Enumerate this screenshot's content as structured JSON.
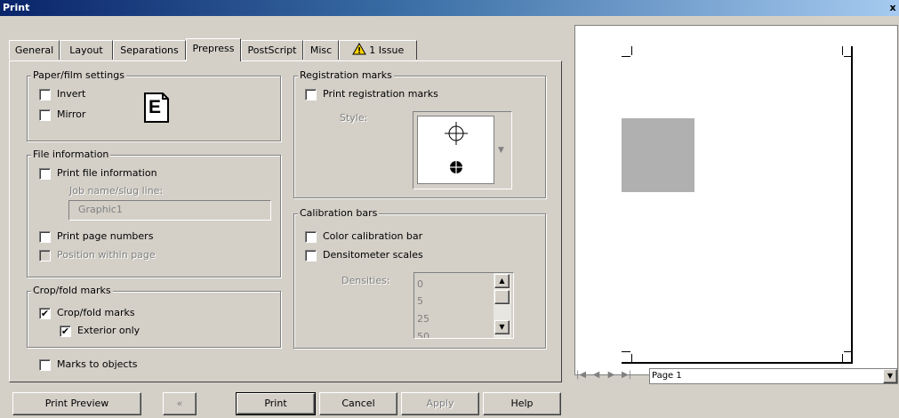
{
  "window": {
    "title": "Print",
    "close_glyph": "x"
  },
  "tabs": [
    {
      "label": "General",
      "active": false
    },
    {
      "label": "Layout",
      "active": false
    },
    {
      "label": "Separations",
      "active": false
    },
    {
      "label": "Prepress",
      "active": true
    },
    {
      "label": "PostScript",
      "active": false
    },
    {
      "label": "Misc",
      "active": false
    },
    {
      "label": "1 Issue",
      "active": false,
      "icon": "warning-icon"
    }
  ],
  "paper_film": {
    "legend": "Paper/film settings",
    "invert": {
      "label": "Invert",
      "checked": false
    },
    "mirror": {
      "label": "Mirror",
      "checked": false
    },
    "preview_letter": "E"
  },
  "file_info": {
    "legend": "File information",
    "print_file_info": {
      "label": "Print file information",
      "checked": false
    },
    "job_name_label": "Job name/slug line:",
    "job_name_value": "Graphic1",
    "print_page_numbers": {
      "label": "Print page numbers",
      "checked": false
    },
    "position_within_page": {
      "label": "Position within page",
      "checked": false,
      "disabled": true
    }
  },
  "crop_fold": {
    "legend": "Crop/fold marks",
    "crop_fold_marks": {
      "label": "Crop/fold marks",
      "checked": true
    },
    "exterior_only": {
      "label": "Exterior only",
      "checked": true
    }
  },
  "marks_to_objects": {
    "label": "Marks to objects",
    "checked": false
  },
  "registration": {
    "legend": "Registration marks",
    "print_registration_marks": {
      "label": "Print registration marks",
      "checked": false
    },
    "style_label": "Style:"
  },
  "calibration": {
    "legend": "Calibration bars",
    "color_calibration_bar": {
      "label": "Color calibration bar",
      "checked": false
    },
    "densitometer_scales": {
      "label": "Densitometer scales",
      "checked": false
    },
    "densities_label": "Densities:",
    "densities_values": [
      "0",
      "5",
      "25",
      "50"
    ]
  },
  "buttons": {
    "print_preview": "Print Preview",
    "collapse_glyph": "«",
    "print": "Print",
    "cancel": "Cancel",
    "apply": "Apply",
    "help": "Help"
  },
  "preview": {
    "page_selector": "Page 1",
    "object_color": "#b0b0b0"
  }
}
